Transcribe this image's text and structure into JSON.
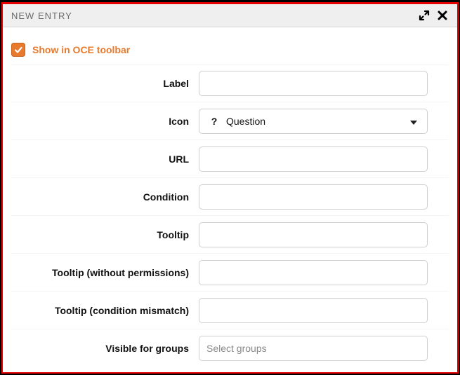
{
  "dialog": {
    "title": "NEW ENTRY"
  },
  "form": {
    "show_in_toolbar_label": "Show in OCE toolbar",
    "show_in_toolbar_checked": true,
    "rows": {
      "label": {
        "label": "Label",
        "value": ""
      },
      "icon": {
        "label": "Icon",
        "selected": "Question",
        "icon_glyph": "?"
      },
      "url": {
        "label": "URL",
        "value": ""
      },
      "condition": {
        "label": "Condition",
        "value": ""
      },
      "tooltip": {
        "label": "Tooltip",
        "value": ""
      },
      "tooltip_noperm": {
        "label": "Tooltip (without permissions)",
        "value": ""
      },
      "tooltip_mismatch": {
        "label": "Tooltip (condition mismatch)",
        "value": ""
      },
      "visible_groups": {
        "label": "Visible for groups",
        "placeholder": "Select groups"
      }
    }
  }
}
